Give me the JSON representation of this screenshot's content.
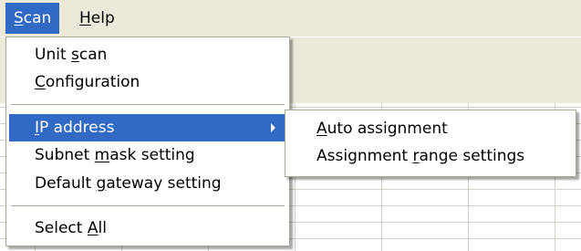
{
  "menubar": {
    "items": [
      {
        "label": "Scan",
        "mnemonic": "S",
        "rest": "can",
        "active": true
      },
      {
        "label": "Help",
        "mnemonic": "H",
        "rest": "elp",
        "active": false
      }
    ]
  },
  "scan_menu": {
    "items": [
      {
        "label": "Unit scan",
        "pre": "Unit ",
        "mnemonic": "s",
        "post": "can"
      },
      {
        "label": "Configuration",
        "pre": "",
        "mnemonic": "C",
        "post": "onfiguration"
      },
      {
        "label": "IP address",
        "pre": "",
        "mnemonic": "I",
        "post": "P address",
        "highlighted": true,
        "has_submenu": true
      },
      {
        "label": "Subnet mask setting",
        "pre": "Subnet ",
        "mnemonic": "m",
        "post": "ask setting"
      },
      {
        "label": "Default gateway setting",
        "pre": "Default ",
        "mnemonic": "g",
        "post": "ateway setting"
      },
      {
        "label": "Select All",
        "pre": "Select ",
        "mnemonic": "A",
        "post": "ll"
      }
    ]
  },
  "ip_submenu": {
    "items": [
      {
        "label": "Auto assignment",
        "pre": "",
        "mnemonic": "A",
        "post": "uto assignment"
      },
      {
        "label": "Assignment range settings",
        "pre": "Assignment ",
        "mnemonic": "r",
        "post": "ange settings"
      }
    ]
  },
  "colors": {
    "highlight": "#316AC5",
    "menu_bg": "#FFFFFF",
    "window_bg": "#ECE9D8"
  }
}
